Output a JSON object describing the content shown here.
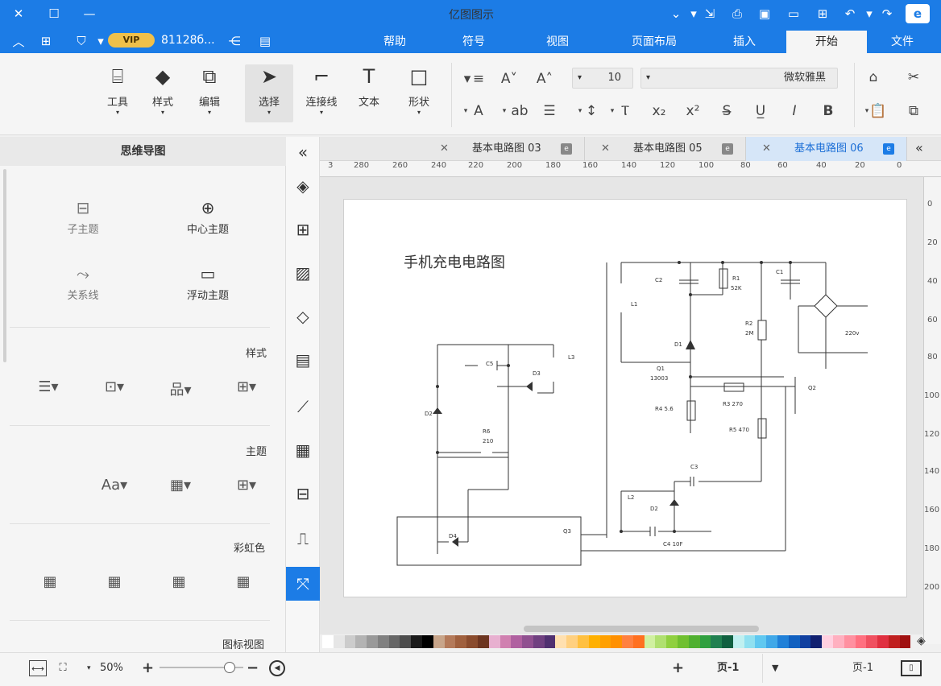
{
  "app": {
    "title": "亿图图示",
    "user": "81128б...",
    "vip": "VIP"
  },
  "menu": {
    "tabs": [
      "文件",
      "开始",
      "插入",
      "页面布局",
      "视图",
      "符号",
      "帮助"
    ],
    "active": "开始"
  },
  "ribbon": {
    "big_buttons": [
      {
        "label": "形状",
        "icon": "rectangle-icon"
      },
      {
        "label": "文本",
        "icon": "text-icon"
      },
      {
        "label": "连接线",
        "icon": "connector-icon"
      },
      {
        "label": "选择",
        "icon": "pointer-icon"
      },
      {
        "label": "编辑",
        "icon": "edit-icon"
      },
      {
        "label": "样式",
        "icon": "style-icon"
      },
      {
        "label": "工具",
        "icon": "tools-icon"
      }
    ],
    "font_name": "微软雅黑",
    "font_size": "10"
  },
  "left_panel": {
    "header": "思维导图",
    "items": [
      {
        "label": "中心主题",
        "icon": "⊕"
      },
      {
        "label": "子主题",
        "icon": "⊟"
      },
      {
        "label": "浮动主题",
        "icon": "▭"
      },
      {
        "label": "关系线",
        "icon": "⤳"
      }
    ],
    "sections": {
      "style": "样式",
      "theme": "主题",
      "rainbow": "彩虹色",
      "icon_view": "图标视图"
    },
    "font_sample": "Aa"
  },
  "doc_tabs": [
    {
      "label": "基本电路图 06",
      "active": true
    },
    {
      "label": "基本电路图 05",
      "active": false
    },
    {
      "label": "基本电路图 03",
      "active": false
    }
  ],
  "ruler": {
    "h_ticks": [
      "0",
      "20",
      "40",
      "60",
      "80",
      "100",
      "120",
      "140",
      "160",
      "180",
      "200",
      "220",
      "240",
      "260",
      "280",
      "3"
    ],
    "v_ticks": [
      "0",
      "20",
      "40",
      "60",
      "80",
      "100",
      "120",
      "140",
      "160",
      "180",
      "200"
    ]
  },
  "diagram": {
    "title": "手机充电电路图",
    "labels": {
      "C1": "C1",
      "C2": "C2",
      "C3": "C3",
      "C4": "C4 10F",
      "C5": "C5",
      "R1": "R1",
      "R1v": "52K",
      "R2": "R2",
      "R2v": "2M",
      "R3": "R3 270",
      "R4": "R4 5.6",
      "R5": "R5 470",
      "R6": "R6",
      "R6v": "210",
      "L1": "L1",
      "L2": "L2",
      "L3": "L3",
      "D1": "D1",
      "D2": "D2",
      "D2b": "D2",
      "D3": "D3",
      "D4": "D4",
      "Q1": "Q1",
      "Q1v": "13003",
      "Q2": "Q2",
      "Q3": "Q3",
      "V": "220v"
    }
  },
  "status": {
    "page": "页-1",
    "page_tab": "页-1",
    "zoom": "50%"
  },
  "colors": {
    "accent": "#1c7ce6",
    "tab_active": "#d6e6f8"
  }
}
